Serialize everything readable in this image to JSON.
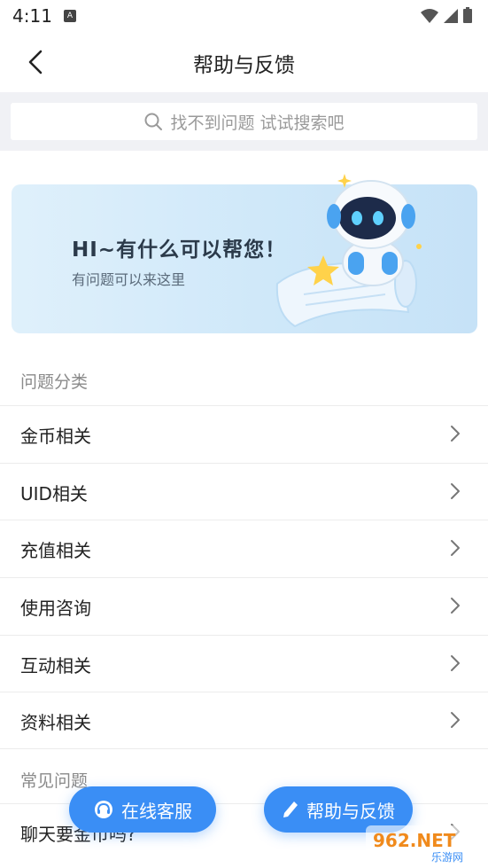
{
  "status_bar": {
    "time": "4:11",
    "notification_icon": "A"
  },
  "header": {
    "title": "帮助与反馈",
    "back_icon": "chevron-left-icon"
  },
  "search": {
    "placeholder": "找不到问题 试试搜索吧"
  },
  "banner": {
    "title": "HI~有什么可以帮您！",
    "subtitle": "有问题可以来这里"
  },
  "categories": {
    "section_label": "问题分类",
    "items": [
      {
        "label": "金币相关"
      },
      {
        "label": "UID相关"
      },
      {
        "label": "充值相关"
      },
      {
        "label": "使用咨询"
      },
      {
        "label": "互动相关"
      },
      {
        "label": "资料相关"
      }
    ]
  },
  "faq": {
    "section_label": "常见问题",
    "items": [
      {
        "label": "聊天要金币吗?"
      }
    ]
  },
  "actions": {
    "service_label": "在线客服",
    "feedback_label": "帮助与反馈"
  },
  "watermark": {
    "text": "962.NET",
    "sub": "乐游网"
  },
  "colors": {
    "accent": "#3a8ef5",
    "background": "#ffffff",
    "search_bg": "#f0f1f5"
  }
}
